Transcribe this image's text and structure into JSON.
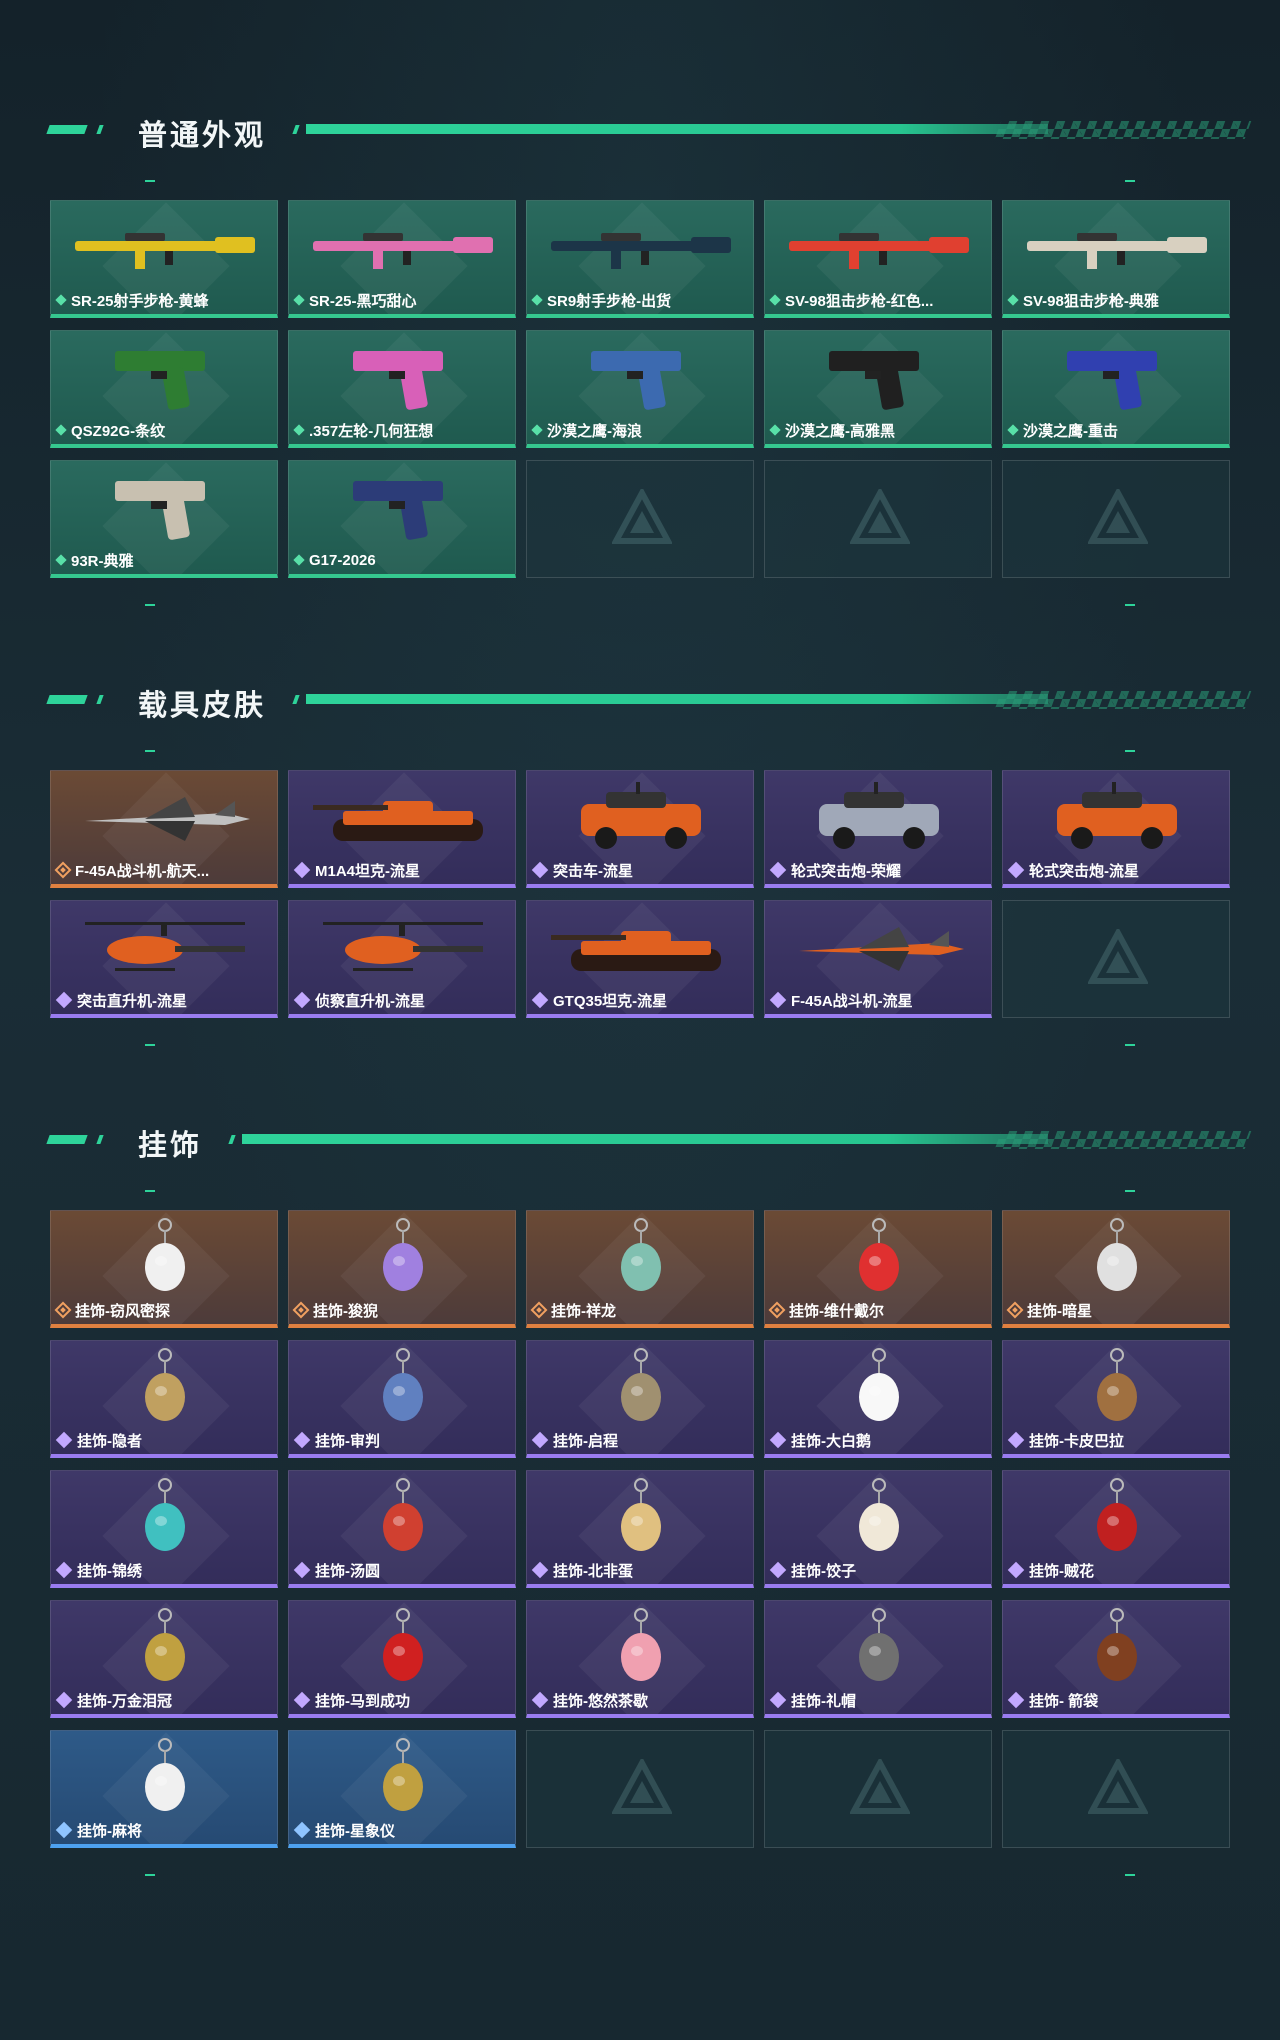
{
  "sections": [
    {
      "title": "普通外观",
      "items": [
        {
          "label": "SR-25射手步枪-黄蜂",
          "rarity": "common",
          "icon": "rifle-yellow-icon",
          "accent": "#e0c020"
        },
        {
          "label": "SR-25-黑巧甜心",
          "rarity": "common",
          "icon": "rifle-pink-icon",
          "accent": "#e070b0"
        },
        {
          "label": "SR9射手步枪-出货",
          "rarity": "common",
          "icon": "rifle-dark-icon",
          "accent": "#1c3548"
        },
        {
          "label": "SV-98狙击步枪-红色...",
          "rarity": "common",
          "icon": "sniper-red-icon",
          "accent": "#e04030"
        },
        {
          "label": "SV-98狙击步枪-典雅",
          "rarity": "common",
          "icon": "sniper-white-icon",
          "accent": "#d8d0c0"
        },
        {
          "label": "QSZ92G-条纹",
          "rarity": "common",
          "icon": "pistol-green-icon",
          "accent": "#2e7d32"
        },
        {
          "label": ".357左轮-几何狂想",
          "rarity": "common",
          "icon": "revolver-pink-icon",
          "accent": "#d860b8"
        },
        {
          "label": "沙漠之鹰-海浪",
          "rarity": "common",
          "icon": "pistol-wave-icon",
          "accent": "#3c6ab0"
        },
        {
          "label": "沙漠之鹰-高雅黑",
          "rarity": "common",
          "icon": "pistol-black-icon",
          "accent": "#202020"
        },
        {
          "label": "沙漠之鹰-重击",
          "rarity": "common",
          "icon": "pistol-blue-white-icon",
          "accent": "#3040b0"
        },
        {
          "label": "93R-典雅",
          "rarity": "common",
          "icon": "pistol-silver-icon",
          "accent": "#c8c0b0"
        },
        {
          "label": "G17-2026",
          "rarity": "common",
          "icon": "pistol-navy-icon",
          "accent": "#2c3c78"
        },
        {
          "label": "",
          "rarity": "empty"
        },
        {
          "label": "",
          "rarity": "empty"
        },
        {
          "label": "",
          "rarity": "empty"
        }
      ]
    },
    {
      "title": "载具皮肤",
      "items": [
        {
          "label": "F-45A战斗机-航天...",
          "rarity": "legendary",
          "icon": "fighter-jet-icon",
          "accent": "#c0c0c0"
        },
        {
          "label": "M1A4坦克-流星",
          "rarity": "epic",
          "icon": "tank-icon",
          "accent": "#e06020"
        },
        {
          "label": "突击车-流星",
          "rarity": "epic",
          "icon": "assault-vehicle-icon",
          "accent": "#e06020"
        },
        {
          "label": "轮式突击炮-荣耀",
          "rarity": "epic",
          "icon": "wheeled-gun-icon",
          "accent": "#a0a8b8"
        },
        {
          "label": "轮式突击炮-流星",
          "rarity": "epic",
          "icon": "wheeled-gun-meteor-icon",
          "accent": "#e06020"
        },
        {
          "label": "突击直升机-流星",
          "rarity": "epic",
          "icon": "attack-helicopter-icon",
          "accent": "#e06020"
        },
        {
          "label": "侦察直升机-流星",
          "rarity": "epic",
          "icon": "scout-helicopter-icon",
          "accent": "#e06020"
        },
        {
          "label": "GTQ35坦克-流星",
          "rarity": "epic",
          "icon": "tank-gtq-icon",
          "accent": "#e06020"
        },
        {
          "label": "F-45A战斗机-流星",
          "rarity": "epic",
          "icon": "fighter-jet-meteor-icon",
          "accent": "#e06020"
        },
        {
          "label": "",
          "rarity": "empty"
        }
      ]
    },
    {
      "title": "挂饰",
      "items": [
        {
          "label": "挂饰-窃风密探",
          "rarity": "legendary",
          "icon": "charm-spy-icon",
          "accent": "#f0f0f0"
        },
        {
          "label": "挂饰-狻猊",
          "rarity": "legendary",
          "icon": "charm-lion-icon",
          "accent": "#a080e0"
        },
        {
          "label": "挂饰-祥龙",
          "rarity": "legendary",
          "icon": "charm-dragon-icon",
          "accent": "#80c0b0"
        },
        {
          "label": "挂饰-维什戴尔",
          "rarity": "legendary",
          "icon": "charm-can-icon",
          "accent": "#e03030"
        },
        {
          "label": "挂饰-暗星",
          "rarity": "legendary",
          "icon": "charm-crane-icon",
          "accent": "#e0e0e0"
        },
        {
          "label": "挂饰-隐者",
          "rarity": "epic",
          "icon": "charm-tarot-hermit-icon",
          "accent": "#c0a060"
        },
        {
          "label": "挂饰-审判",
          "rarity": "epic",
          "icon": "charm-tarot-judgement-icon",
          "accent": "#6080c0"
        },
        {
          "label": "挂饰-启程",
          "rarity": "epic",
          "icon": "charm-compass-icon",
          "accent": "#a09070"
        },
        {
          "label": "挂饰-大白鹅",
          "rarity": "epic",
          "icon": "charm-goose-icon",
          "accent": "#f8f8f8"
        },
        {
          "label": "挂饰-卡皮巴拉",
          "rarity": "epic",
          "icon": "charm-capybara-icon",
          "accent": "#a07040"
        },
        {
          "label": "挂饰-锦绣",
          "rarity": "epic",
          "icon": "charm-butterfly-icon",
          "accent": "#40c0c0"
        },
        {
          "label": "挂饰-汤圆",
          "rarity": "epic",
          "icon": "charm-tangyuan-icon",
          "accent": "#d04030"
        },
        {
          "label": "挂饰-北非蛋",
          "rarity": "epic",
          "icon": "charm-shakshuka-icon",
          "accent": "#e0c080"
        },
        {
          "label": "挂饰-饺子",
          "rarity": "epic",
          "icon": "charm-dumpling-icon",
          "accent": "#f0e8d8"
        },
        {
          "label": "挂饰-贼花",
          "rarity": "epic",
          "icon": "charm-rose-icon",
          "accent": "#c02020"
        },
        {
          "label": "挂饰-万金泪冠",
          "rarity": "epic",
          "icon": "charm-burger-icon",
          "accent": "#c0a040"
        },
        {
          "label": "挂饰-马到成功",
          "rarity": "epic",
          "icon": "charm-horse-icon",
          "accent": "#d02020"
        },
        {
          "label": "挂饰-悠然茶歇",
          "rarity": "epic",
          "icon": "charm-cupcake-icon",
          "accent": "#f0a0b0"
        },
        {
          "label": "挂饰-礼帽",
          "rarity": "epic",
          "icon": "charm-hat-icon",
          "accent": "#707070"
        },
        {
          "label": "挂饰- 箭袋",
          "rarity": "epic",
          "icon": "charm-quiver-icon",
          "accent": "#804020"
        },
        {
          "label": "挂饰-麻将",
          "rarity": "rare",
          "icon": "charm-mahjong-icon",
          "accent": "#f0f0f0"
        },
        {
          "label": "挂饰-星象仪",
          "rarity": "rare",
          "icon": "charm-astrolabe-icon",
          "accent": "#c0a040"
        },
        {
          "label": "",
          "rarity": "empty"
        },
        {
          "label": "",
          "rarity": "empty"
        },
        {
          "label": "",
          "rarity": "empty"
        }
      ]
    }
  ],
  "colors": {
    "common": "#35c88f",
    "epic": "#9a7cf0",
    "legendary": "#e08040",
    "rare": "#4ea1f0"
  }
}
